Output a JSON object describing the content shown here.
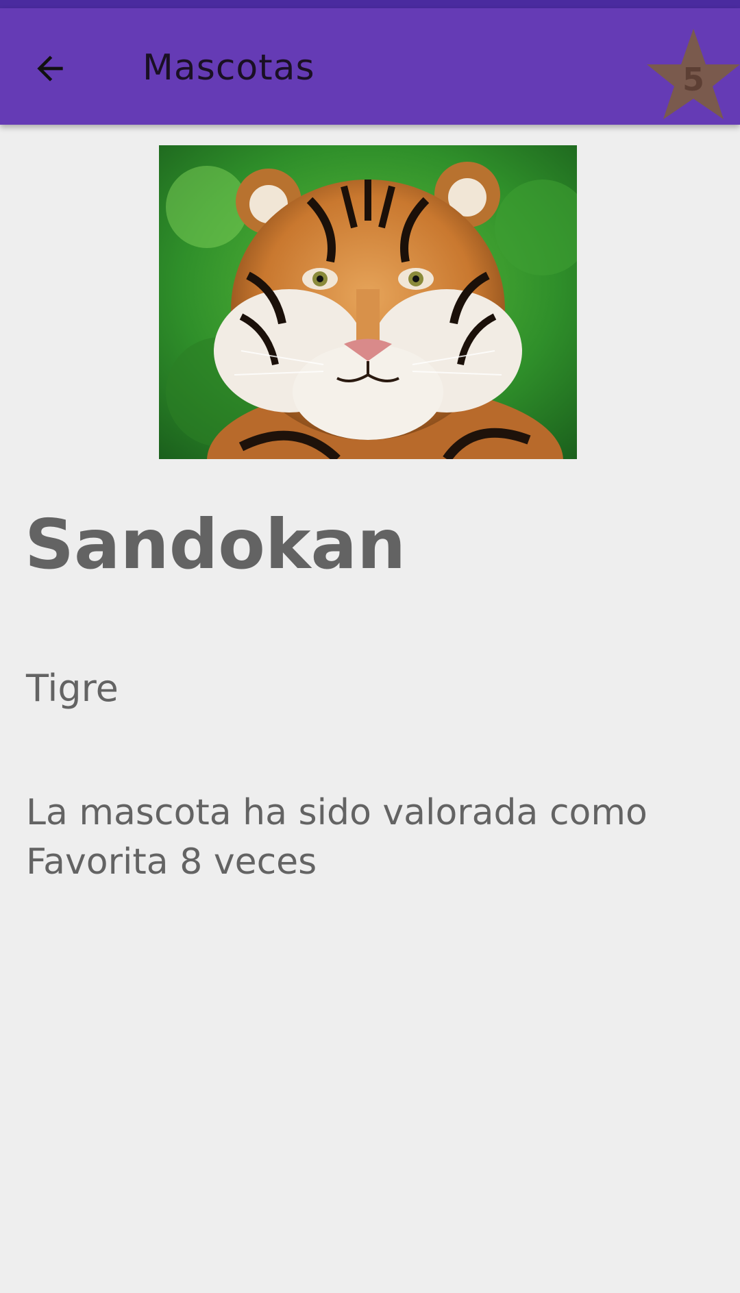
{
  "app_bar": {
    "title": "Mascotas",
    "back_icon": "arrow-back-icon",
    "favorites_count": "5",
    "favorites_icon": "star-icon",
    "bar_color": "#653bb5",
    "star_color": "#7a5a4d"
  },
  "pet": {
    "photo_subject": "tiger",
    "name": "Sandokan",
    "type": "Tigre",
    "rating_text": "La mascota ha sido valorada como Favorita 8 veces"
  }
}
